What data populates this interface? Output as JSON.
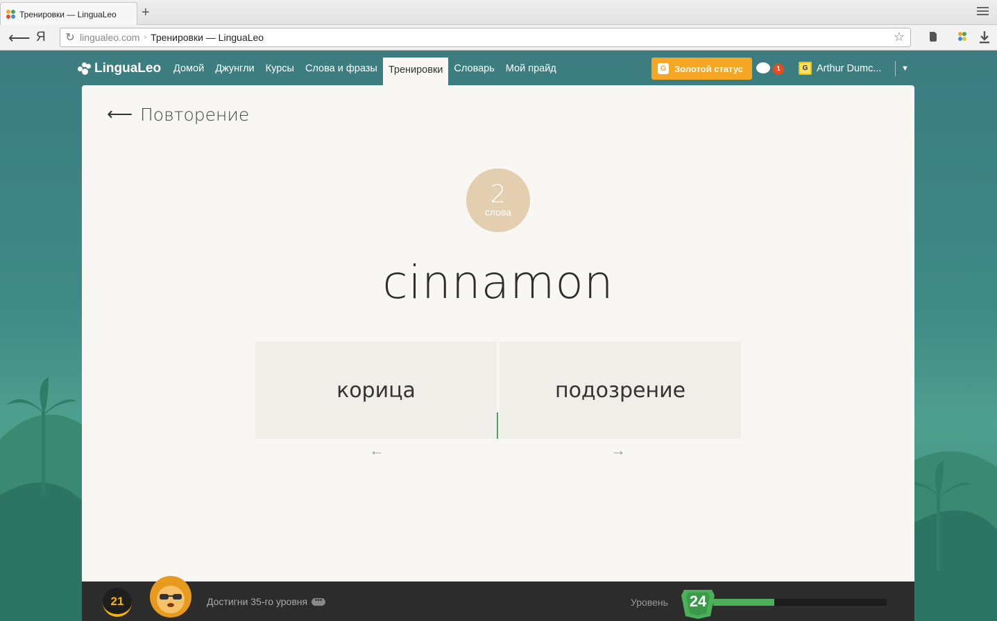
{
  "browser": {
    "tab_title": "Тренировки — LinguaLeo",
    "new_tab": "+",
    "url_host": "lingualeo.com",
    "url_separator": "›",
    "page_title": "Тренировки — LinguaLeo",
    "yandex_button": "Я"
  },
  "header": {
    "logo": "LinguaLeo",
    "nav": [
      "Домой",
      "Джунгли",
      "Курсы",
      "Слова и фразы",
      "Тренировки",
      "Словарь",
      "Мой прайд"
    ],
    "active_nav": "Тренировки",
    "gold_status": "Золотой статус",
    "gold_icon_letter": "G",
    "notifications_count": "1",
    "user_name": "Arthur Dumc...",
    "user_icon_letter": "G"
  },
  "training": {
    "title": "Повторение",
    "words_count": "2",
    "words_label": "слова",
    "word": "cinnamon",
    "answers": [
      "корица",
      "подозрение"
    ],
    "left_hint": "←",
    "right_hint": "→"
  },
  "bottom": {
    "coins": "21",
    "goal_text": "Достигни 35-го уровня",
    "goal_more": "•••",
    "level_label": "Уровень",
    "level": "24",
    "level_progress": 0.35
  },
  "colors": {
    "gold": "#f5a623",
    "progress": "#4cb05a",
    "count_circle": "#e3cfaf",
    "badge": "#e94b1d"
  }
}
